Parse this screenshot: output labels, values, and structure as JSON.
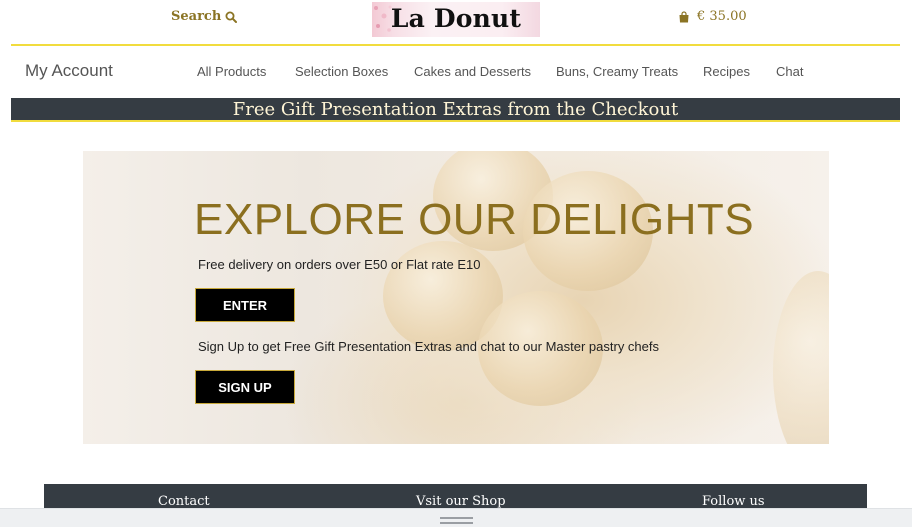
{
  "header": {
    "search_label": "Search",
    "logo_text": "La Donut",
    "cart_total": "€ 35.00"
  },
  "nav": {
    "account_label": "My Account",
    "items": [
      {
        "label": "All Products"
      },
      {
        "label": "Selection Boxes"
      },
      {
        "label": "Cakes and Desserts"
      },
      {
        "label": "Buns, Creamy Treats"
      },
      {
        "label": "Recipes"
      },
      {
        "label": "Chat"
      }
    ]
  },
  "banner": {
    "text": "Free Gift Presentation Extras from the Checkout"
  },
  "hero": {
    "title": "EXPLORE OUR DELIGHTS",
    "delivery_text": "Free delivery on orders over E50 or Flat rate E10",
    "enter_label": "ENTER",
    "signup_text": "Sign Up to get Free Gift Presentation Extras and chat to our Master pastry chefs",
    "signup_label": "SIGN UP"
  },
  "footer": {
    "columns": [
      {
        "label": "Contact"
      },
      {
        "label": "Vsit our Shop"
      },
      {
        "label": "Follow us"
      }
    ]
  },
  "colors": {
    "accent_gold": "#8b6f1f",
    "divider_yellow": "#f1dc3d",
    "dark_strip": "#353c43"
  },
  "icons": {
    "search": "search-icon",
    "cart": "shopping-bag-icon"
  }
}
